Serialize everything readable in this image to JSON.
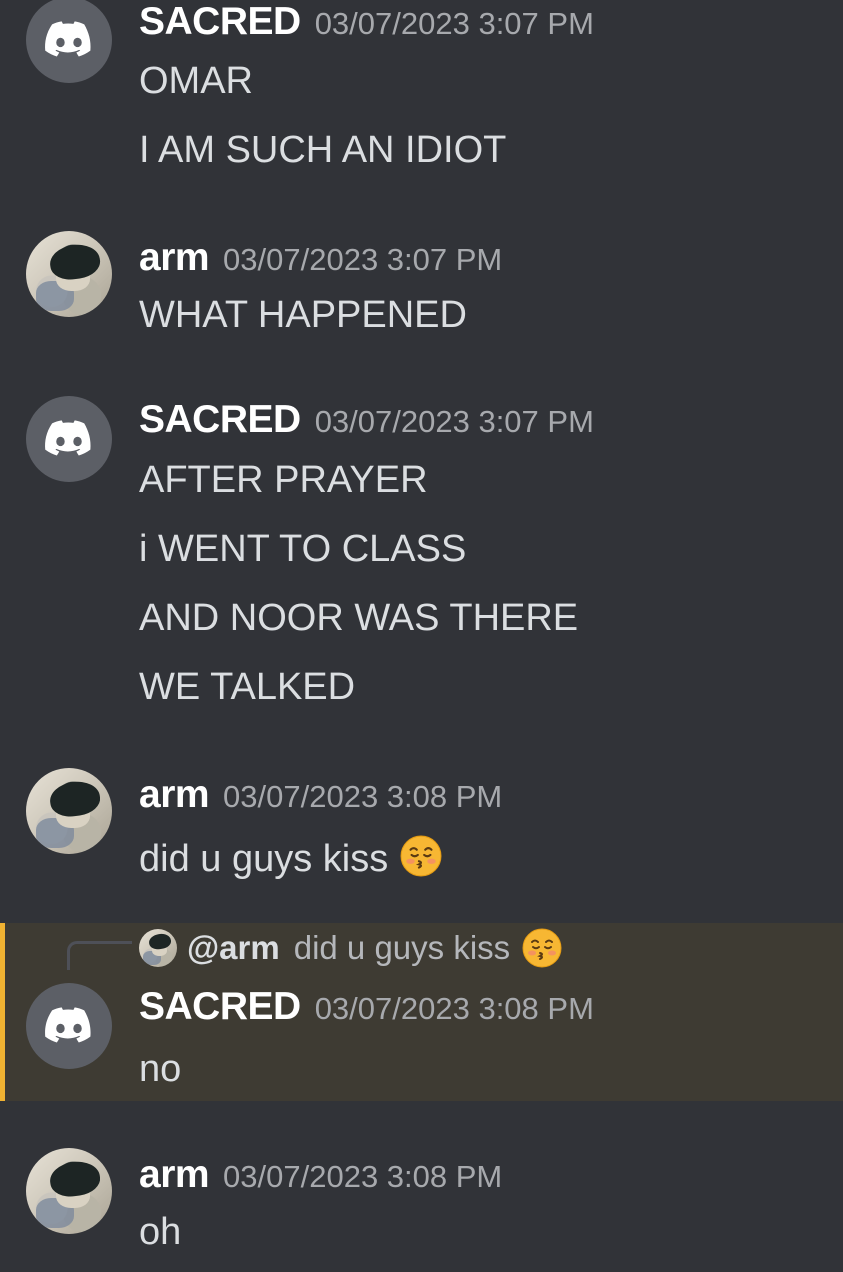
{
  "colors": {
    "background": "#313338",
    "highlight": "#3e3b33",
    "highlight_bar": "#f0b232",
    "username": "#ffffff",
    "timestamp": "#a7a9ad",
    "text": "#dbdee1"
  },
  "messages": [
    {
      "author": "SACRED",
      "avatar": "discord-logo-icon",
      "timestamp": "03/07/2023 3:07 PM",
      "lines": [
        "OMAR",
        "I AM SUCH AN IDIOT"
      ]
    },
    {
      "author": "arm",
      "avatar": "user-photo",
      "timestamp": "03/07/2023 3:07 PM",
      "lines": [
        "WHAT HAPPENED"
      ]
    },
    {
      "author": "SACRED",
      "avatar": "discord-logo-icon",
      "timestamp": "03/07/2023 3:07 PM",
      "lines": [
        "AFTER PRAYER",
        "i WENT TO CLASS",
        "AND NOOR WAS THERE",
        "WE TALKED"
      ]
    },
    {
      "author": "arm",
      "avatar": "user-photo",
      "timestamp": "03/07/2023 3:08 PM",
      "lines": [
        "did u guys kiss"
      ],
      "emoji": "kissing-face-closed-eyes-icon"
    },
    {
      "author": "SACRED",
      "avatar": "discord-logo-icon",
      "timestamp": "03/07/2023 3:08 PM",
      "lines": [
        "no"
      ],
      "highlighted": true,
      "reply": {
        "mention": "@arm",
        "text": "did u guys kiss",
        "emoji": "kissing-face-closed-eyes-icon"
      }
    },
    {
      "author": "arm",
      "avatar": "user-photo",
      "timestamp": "03/07/2023 3:08 PM",
      "lines": [
        "oh"
      ]
    }
  ]
}
